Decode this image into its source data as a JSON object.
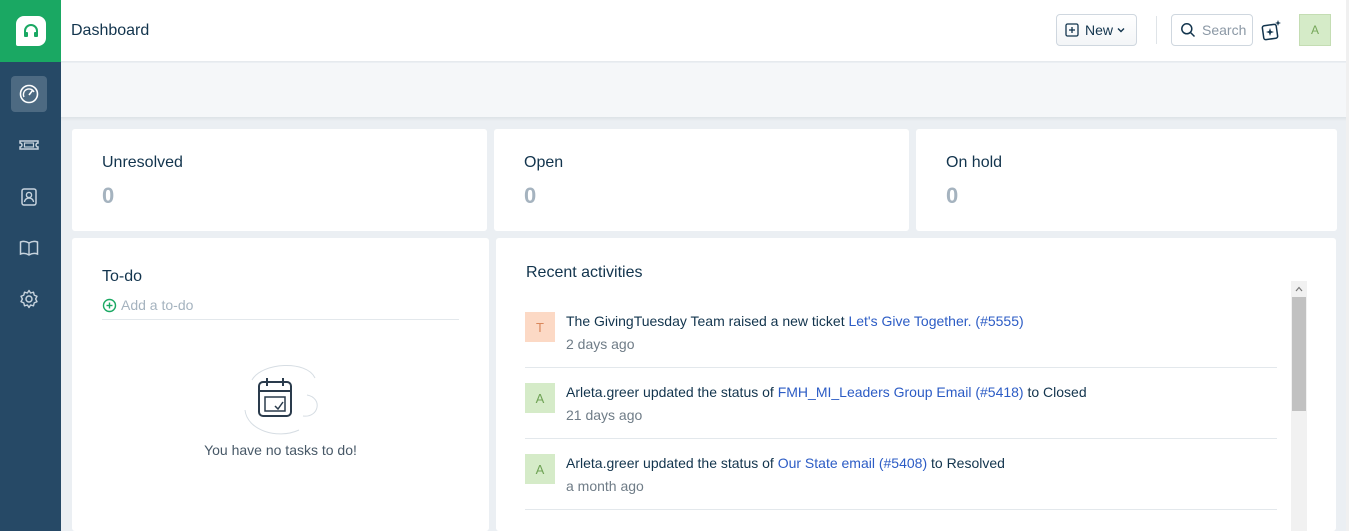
{
  "header": {
    "title": "Dashboard",
    "new_label": "New",
    "search_placeholder": "Search",
    "avatar_initial": "A"
  },
  "sidebar": {
    "items": [
      {
        "name": "dashboard",
        "icon": "gauge-icon",
        "active": true
      },
      {
        "name": "tickets",
        "icon": "ticket-icon",
        "active": false
      },
      {
        "name": "contacts",
        "icon": "contact-icon",
        "active": false
      },
      {
        "name": "knowledge-base",
        "icon": "book-icon",
        "active": false
      },
      {
        "name": "admin",
        "icon": "gear-icon",
        "active": false
      }
    ]
  },
  "stats": [
    {
      "label": "Unresolved",
      "value": "0"
    },
    {
      "label": "Open",
      "value": "0"
    },
    {
      "label": "On hold",
      "value": "0"
    }
  ],
  "todo": {
    "title": "To-do",
    "add_placeholder": "Add a to-do",
    "empty_message": "You have no tasks to do!"
  },
  "activities": {
    "title": "Recent activities",
    "items": [
      {
        "avatar": "T",
        "text_before": "The GivingTuesday Team raised a new ticket ",
        "link": "Let's Give Together. (#5555)",
        "text_after": "",
        "time": "2 days ago"
      },
      {
        "avatar": "A",
        "text_before": "Arleta.greer updated the status of ",
        "link": "FMH_MI_Leaders Group Email (#5418)",
        "text_after": " to Closed",
        "time": "21 days ago"
      },
      {
        "avatar": "A",
        "text_before": "Arleta.greer updated the status of ",
        "link": "Our State email (#5408)",
        "text_after": " to Resolved",
        "time": "a month ago"
      }
    ]
  },
  "colors": {
    "sidebar_bg": "#264966",
    "logo_bg": "#1aa863",
    "link": "#2c5cc5",
    "stat_value": "#a5b3bf"
  }
}
